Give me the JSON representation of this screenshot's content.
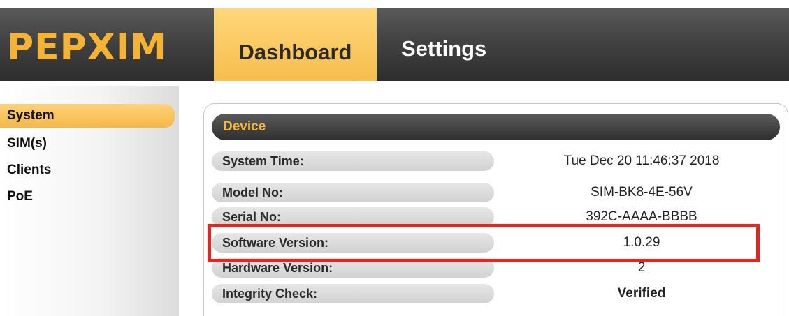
{
  "app": {
    "logo": "PEPXIM"
  },
  "tabs": [
    {
      "label": "Dashboard",
      "active": true
    },
    {
      "label": "Settings",
      "active": false
    }
  ],
  "sidebar": {
    "items": [
      {
        "label": "System",
        "active": true
      },
      {
        "label": "SIM(s)",
        "active": false
      },
      {
        "label": "Clients",
        "active": false
      },
      {
        "label": "PoE",
        "active": false
      }
    ]
  },
  "device": {
    "title": "Device",
    "rows": [
      {
        "label": "System Time:",
        "value": "Tue Dec 20 11:46:37 2018"
      },
      {
        "label": "Model No:",
        "value": "SIM-BK8-4E-56V"
      },
      {
        "label": "Serial No:",
        "value": "392C-AAAA-BBBB"
      },
      {
        "label": "Software Version:",
        "value": "1.0.29"
      },
      {
        "label": "Hardware Version:",
        "value": "2"
      },
      {
        "label": "Integrity Check:",
        "value": "Verified"
      }
    ]
  },
  "colors": {
    "accent": "#f5b335",
    "highlight": "#e3261f",
    "header_dark": "#3a3a3a"
  }
}
